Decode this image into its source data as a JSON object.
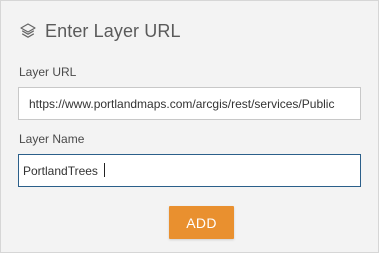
{
  "header": {
    "title": "Enter Layer URL",
    "icon": "layers-icon"
  },
  "form": {
    "url_label": "Layer URL",
    "url_value": "https://www.portlandmaps.com/arcgis/rest/services/Public",
    "name_label": "Layer Name",
    "name_value": "PortlandTrees"
  },
  "actions": {
    "add_label": "ADD"
  },
  "colors": {
    "accent": "#e9902f",
    "panel_bg": "#f3f3f3",
    "focus_border": "#2b5f8a"
  }
}
